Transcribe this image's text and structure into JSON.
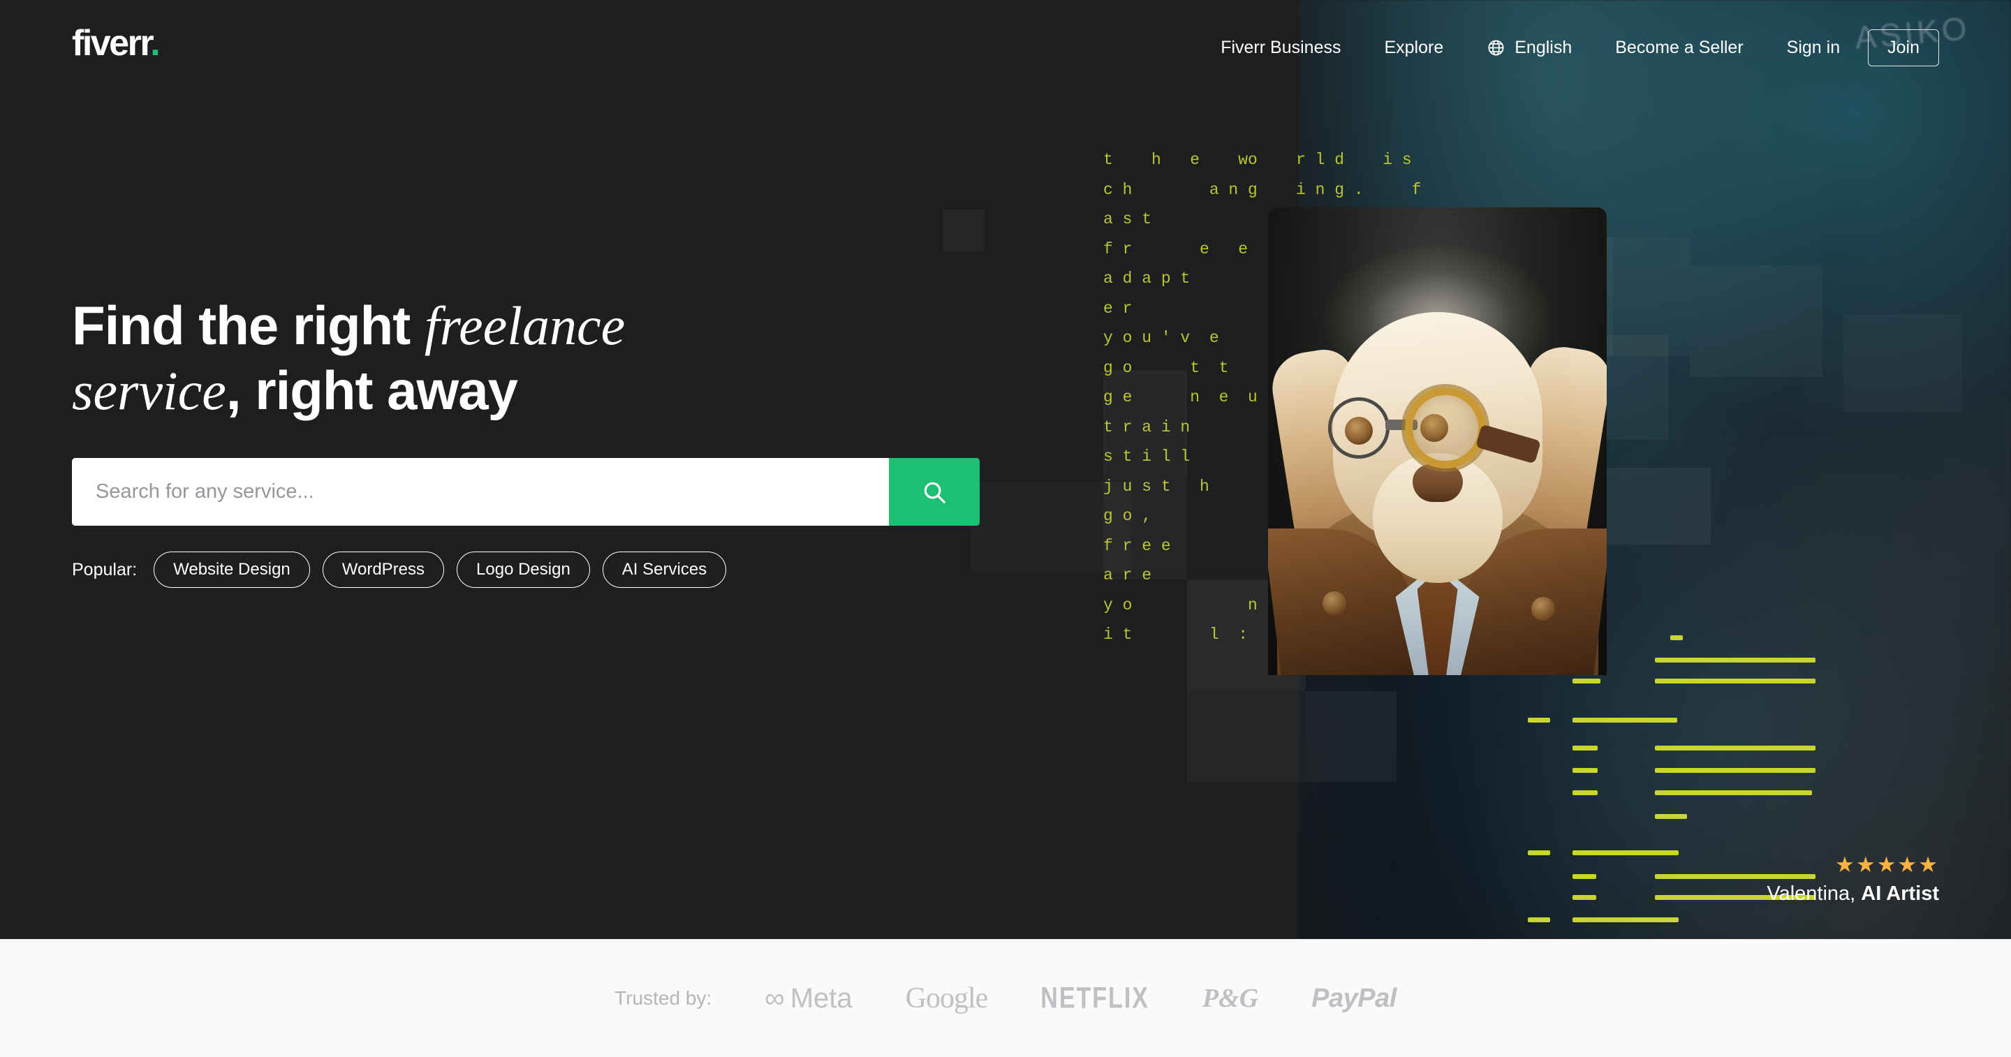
{
  "header": {
    "logo_text": "fiverr",
    "logo_dot": ".",
    "nav": [
      {
        "label": "Fiverr Business",
        "name": "nav-fiverr-business"
      },
      {
        "label": "Explore",
        "name": "nav-explore"
      }
    ],
    "language": {
      "label": "English",
      "icon": "globe-icon"
    },
    "become_seller": "Become a Seller",
    "sign_in": "Sign in",
    "join": "Join"
  },
  "hero": {
    "headline_part1": "Find the right ",
    "headline_em1": "freelance",
    "headline_em2": "service",
    "headline_part2": ", right away",
    "search": {
      "placeholder": "Search for any service...",
      "value": "",
      "button_icon": "search-icon"
    },
    "popular_label": "Popular:",
    "popular_tags": [
      "Website Design",
      "WordPress",
      "Logo Design",
      "AI Services"
    ],
    "background_sign": "ASIKO",
    "matrix_text": "t    h   e    wo    r l d    i s\nc h        a n g    i n g .     f\na s t\nf r       e   e\na d a p t\ne r\ny o u ' v  e\ng o      t  t\ng e      n  e  u\nt r a i n\ns t i l l\nj u s t   h\ng o ,\nf r e e\na r e\ny o            n\ni t        l  :",
    "testimonial": {
      "stars": "★★★★★",
      "rating": 5,
      "name": "Valentina,",
      "role": "AI Artist"
    }
  },
  "trusted": {
    "label": "Trusted by:",
    "brands": [
      {
        "name": "Meta",
        "glyph": "∞",
        "text": "Meta"
      },
      {
        "name": "Google",
        "text": "Google"
      },
      {
        "name": "NETFLIX",
        "text": "NETFLIX"
      },
      {
        "name": "P&G",
        "text": "P&G"
      },
      {
        "name": "PayPal",
        "text": "PayPal"
      }
    ]
  },
  "colors": {
    "brand_green": "#1dbf73",
    "hero_bg": "#1d1e20",
    "matrix_green": "#c8d32e",
    "star_gold": "#ffb33e",
    "trusted_bg": "#fafafa"
  }
}
